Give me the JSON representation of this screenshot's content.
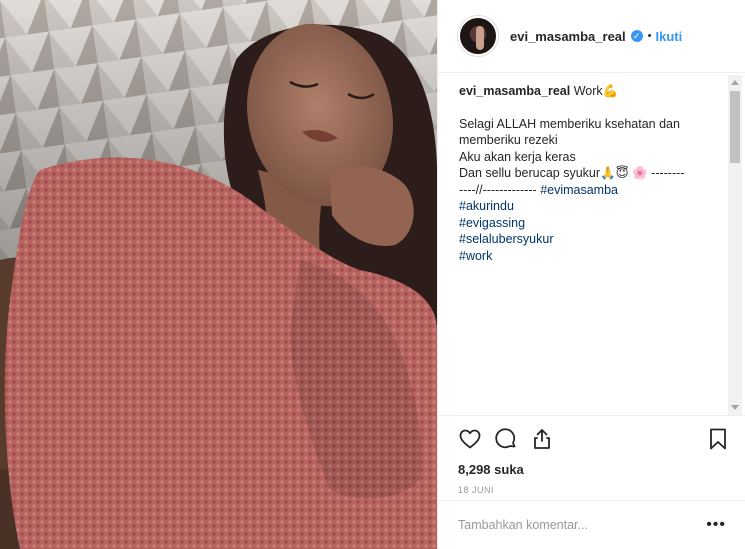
{
  "post": {
    "username": "evi_masamba_real",
    "verified_icon": "verified-badge-icon",
    "separator": "•",
    "follow_label": "Ikuti"
  },
  "caption": {
    "author": "evi_masamba_real",
    "first_line": "Work💪",
    "body_lines": [
      "Selagi ALLAH memberiku ksehatan dan",
      "memberiku rezeki",
      "Aku akan kerja keras",
      "Dan sellu berucap syukur🙏😇 🌸 --------",
      "----//------------- "
    ],
    "inline_hashtag": "#evimasamba",
    "hashtags": [
      "#akurindu",
      "#evigassing",
      "#selalubersyukur",
      "#work"
    ]
  },
  "actions": {
    "like_icon": "heart-icon",
    "comment_icon": "comment-bubble-icon",
    "share_icon": "share-icon",
    "save_icon": "bookmark-icon",
    "likes_text": "8,298 suka",
    "date_text": "18 JUNI"
  },
  "comment_box": {
    "placeholder": "Tambahkan komentar...",
    "more_label": "•••"
  },
  "colors": {
    "accent": "#3897f0",
    "hashtag": "#003569",
    "sweater": "#c66a66"
  }
}
